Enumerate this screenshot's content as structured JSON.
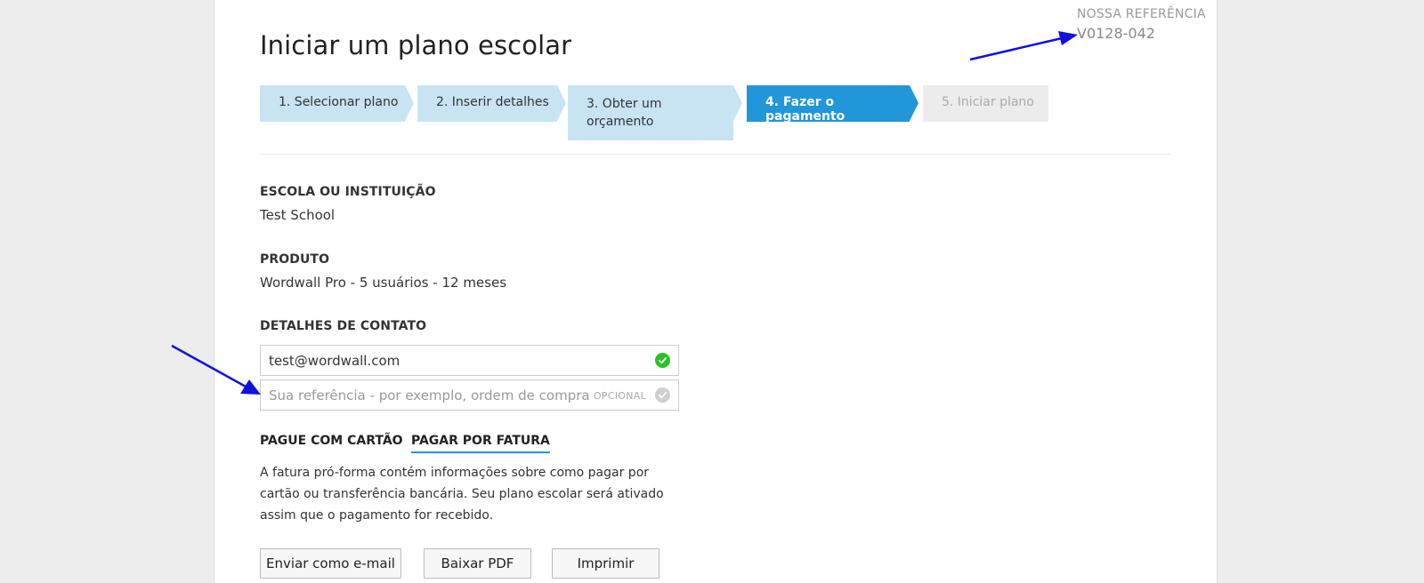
{
  "page": {
    "title": "Iniciar um plano escolar"
  },
  "reference": {
    "label": "NOSSA REFERÊNCIA",
    "value": "V0128-042"
  },
  "steps": [
    {
      "label": "1. Selecionar plano",
      "state": "completed"
    },
    {
      "label": "2. Inserir detalhes",
      "state": "completed"
    },
    {
      "label": "3. Obter um orçamento",
      "state": "completed"
    },
    {
      "label": "4. Fazer o pagamento",
      "state": "active"
    },
    {
      "label": "5. Iniciar plano",
      "state": "disabled"
    }
  ],
  "school": {
    "label": "ESCOLA OU INSTITUIÇÃO",
    "value": "Test School"
  },
  "product": {
    "label": "PRODUTO",
    "value": "Wordwall Pro - 5 usuários - 12 meses"
  },
  "contact": {
    "label": "DETALHES DE CONTATO",
    "email_value": "test@wordwall.com",
    "reference_placeholder": "Sua referência - por exemplo, ordem de compra",
    "reference_value": "",
    "optional_label": "OPCIONAL"
  },
  "payment_tabs": [
    {
      "label": "PAGUE COM CARTÃO",
      "selected": false
    },
    {
      "label": "PAGAR POR FATURA",
      "selected": true
    }
  ],
  "invoice_description": "A fatura pró-forma contém informações sobre como pagar por cartão ou transferência bancária. Seu plano escolar será ativado assim que o pagamento for recebido.",
  "actions": {
    "email_label": "Enviar como e-mail",
    "pdf_label": "Baixar PDF",
    "print_label": "Imprimir"
  },
  "icons": {
    "email_check": "check-circle-icon",
    "reference_check": "check-circle-icon"
  },
  "colors": {
    "accent": "#2196d9",
    "step_light": "#c8e4f3",
    "success": "#29c229",
    "annotation": "#1010e0"
  }
}
